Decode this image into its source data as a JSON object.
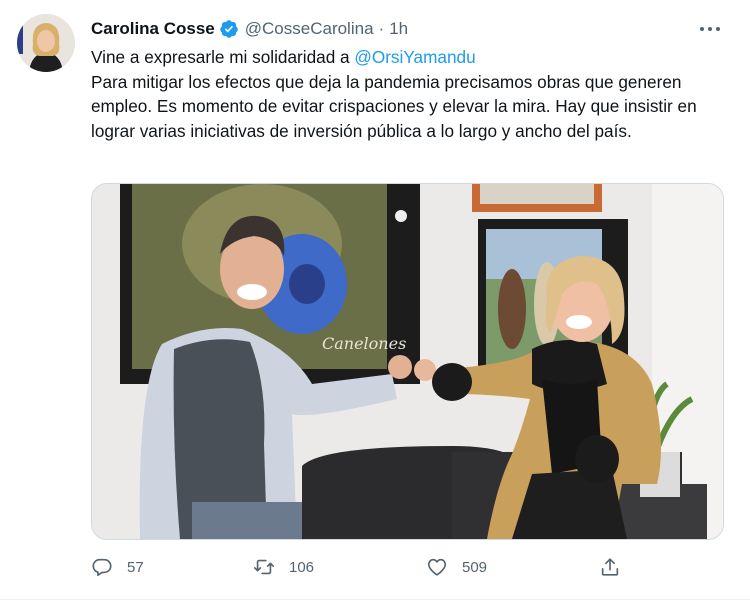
{
  "tweet": {
    "author_name": "Carolina Cosse",
    "handle": "@CosseCarolina",
    "separator": "·",
    "time": "1h",
    "line1_prefix": "Vine a expresarle mi solidaridad a ",
    "line1_mention": "@OrsiYamandu",
    "body": "Para mitigar los efectos que deja la pandemia precisamos obras que generen empleo. Es momento de evitar crispaciones y elevar la mira. Hay que insistir en lograr varias iniciativas de inversión pública a lo largo y ancho del país.",
    "poster_caption": "Canelones"
  },
  "actions": {
    "reply_count": "57",
    "retweet_count": "106",
    "like_count": "509"
  },
  "colors": {
    "accent": "#1d9bf0",
    "secondary_text": "#536471",
    "primary_text": "#0f1419"
  },
  "icons": [
    "verified-badge-icon",
    "more-dots-icon",
    "reply-icon",
    "retweet-icon",
    "like-icon",
    "share-icon"
  ]
}
